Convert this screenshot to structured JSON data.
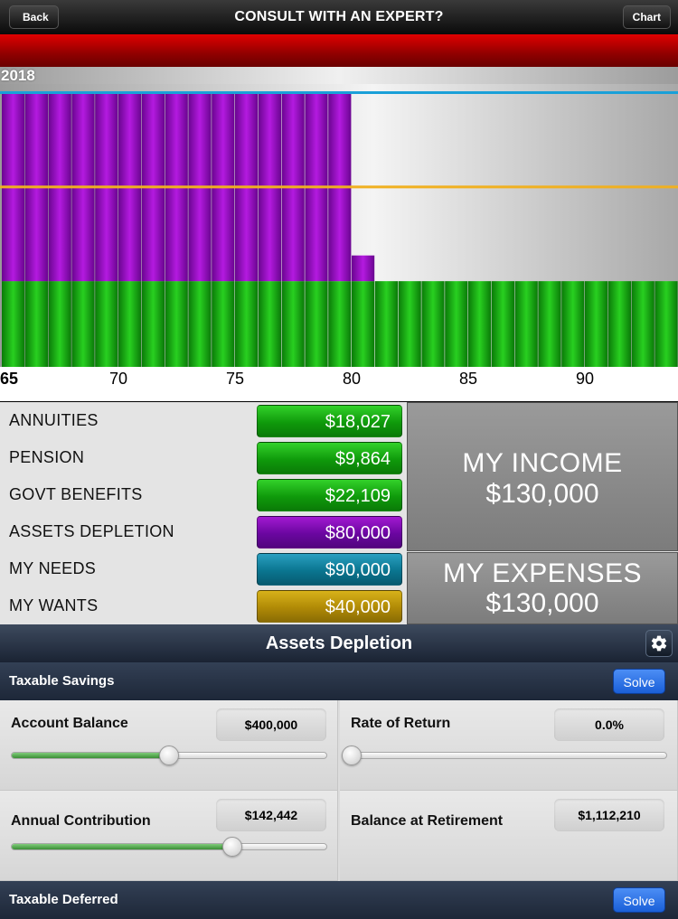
{
  "nav": {
    "back_label": "Back",
    "title": "CONSULT WITH AN EXPERT?",
    "chart_label": "Chart"
  },
  "chart_data": {
    "type": "bar",
    "title": "2018",
    "x_tick_labels": [
      "65",
      "70",
      "75",
      "80",
      "85",
      "90"
    ],
    "x_range": [
      65,
      93
    ],
    "stack_levels": {
      "green_top": 1,
      "purple_full_top": 3,
      "blue_line": 3.2,
      "orange_line": 2.1
    },
    "series": [
      {
        "values": [
          1,
          1,
          1,
          1,
          1,
          1,
          1,
          1,
          1,
          1,
          1,
          1,
          1,
          1,
          1,
          1,
          1,
          1,
          1,
          1,
          1,
          1,
          1,
          1,
          1,
          1,
          1,
          1,
          1
        ]
      },
      {
        "values": [
          2.2,
          2.2,
          2.2,
          2.2,
          2.2,
          2.2,
          2.2,
          2.2,
          2.2,
          2.2,
          2.2,
          2.2,
          2.2,
          2.2,
          2.2,
          0.3,
          0,
          0,
          0,
          0,
          0,
          0,
          0,
          0,
          0,
          0,
          0,
          0,
          0
        ]
      }
    ],
    "colors": {
      "guaranteed": "#14a80f",
      "assets_depletion": "#8e0bb8",
      "needs_line": "#1aa0d8",
      "wants_line": "#f0b020"
    },
    "grid": false
  },
  "summary": {
    "rows": [
      {
        "label": "ANNUITIES",
        "value": "$18,027",
        "color": "green"
      },
      {
        "label": "PENSION",
        "value": "$9,864",
        "color": "green"
      },
      {
        "label": "GOVT BENEFITS",
        "value": "$22,109",
        "color": "green"
      },
      {
        "label": "ASSETS DEPLETION",
        "value": "$80,000",
        "color": "purple"
      },
      {
        "label": "MY NEEDS",
        "value": "$90,000",
        "color": "teal"
      },
      {
        "label": "MY WANTS",
        "value": "$40,000",
        "color": "gold"
      }
    ],
    "income": {
      "label": "MY INCOME",
      "value": "$130,000"
    },
    "expenses": {
      "label": "MY EXPENSES",
      "value": "$130,000"
    }
  },
  "panel": {
    "title": "Assets Depletion",
    "gear_icon": "gear-icon",
    "taxable_section": "Taxable Savings",
    "solve_label": "Solve",
    "account_balance_label": "Account Balance",
    "account_balance_value": "$400,000",
    "account_balance_slider": 0.5,
    "rate_of_return_label": "Rate of Return",
    "rate_of_return_value": "0.0%",
    "rate_of_return_slider": 0.0,
    "annual_contribution_label": "Annual Contribution",
    "annual_contribution_value": "$142,442",
    "annual_contribution_slider": 0.7,
    "balance_at_retirement_label": "Balance at Retirement",
    "balance_at_retirement_value": "$1,112,210",
    "deferred_section": "Taxable Deferred",
    "deferred_solve_label": "Solve"
  }
}
